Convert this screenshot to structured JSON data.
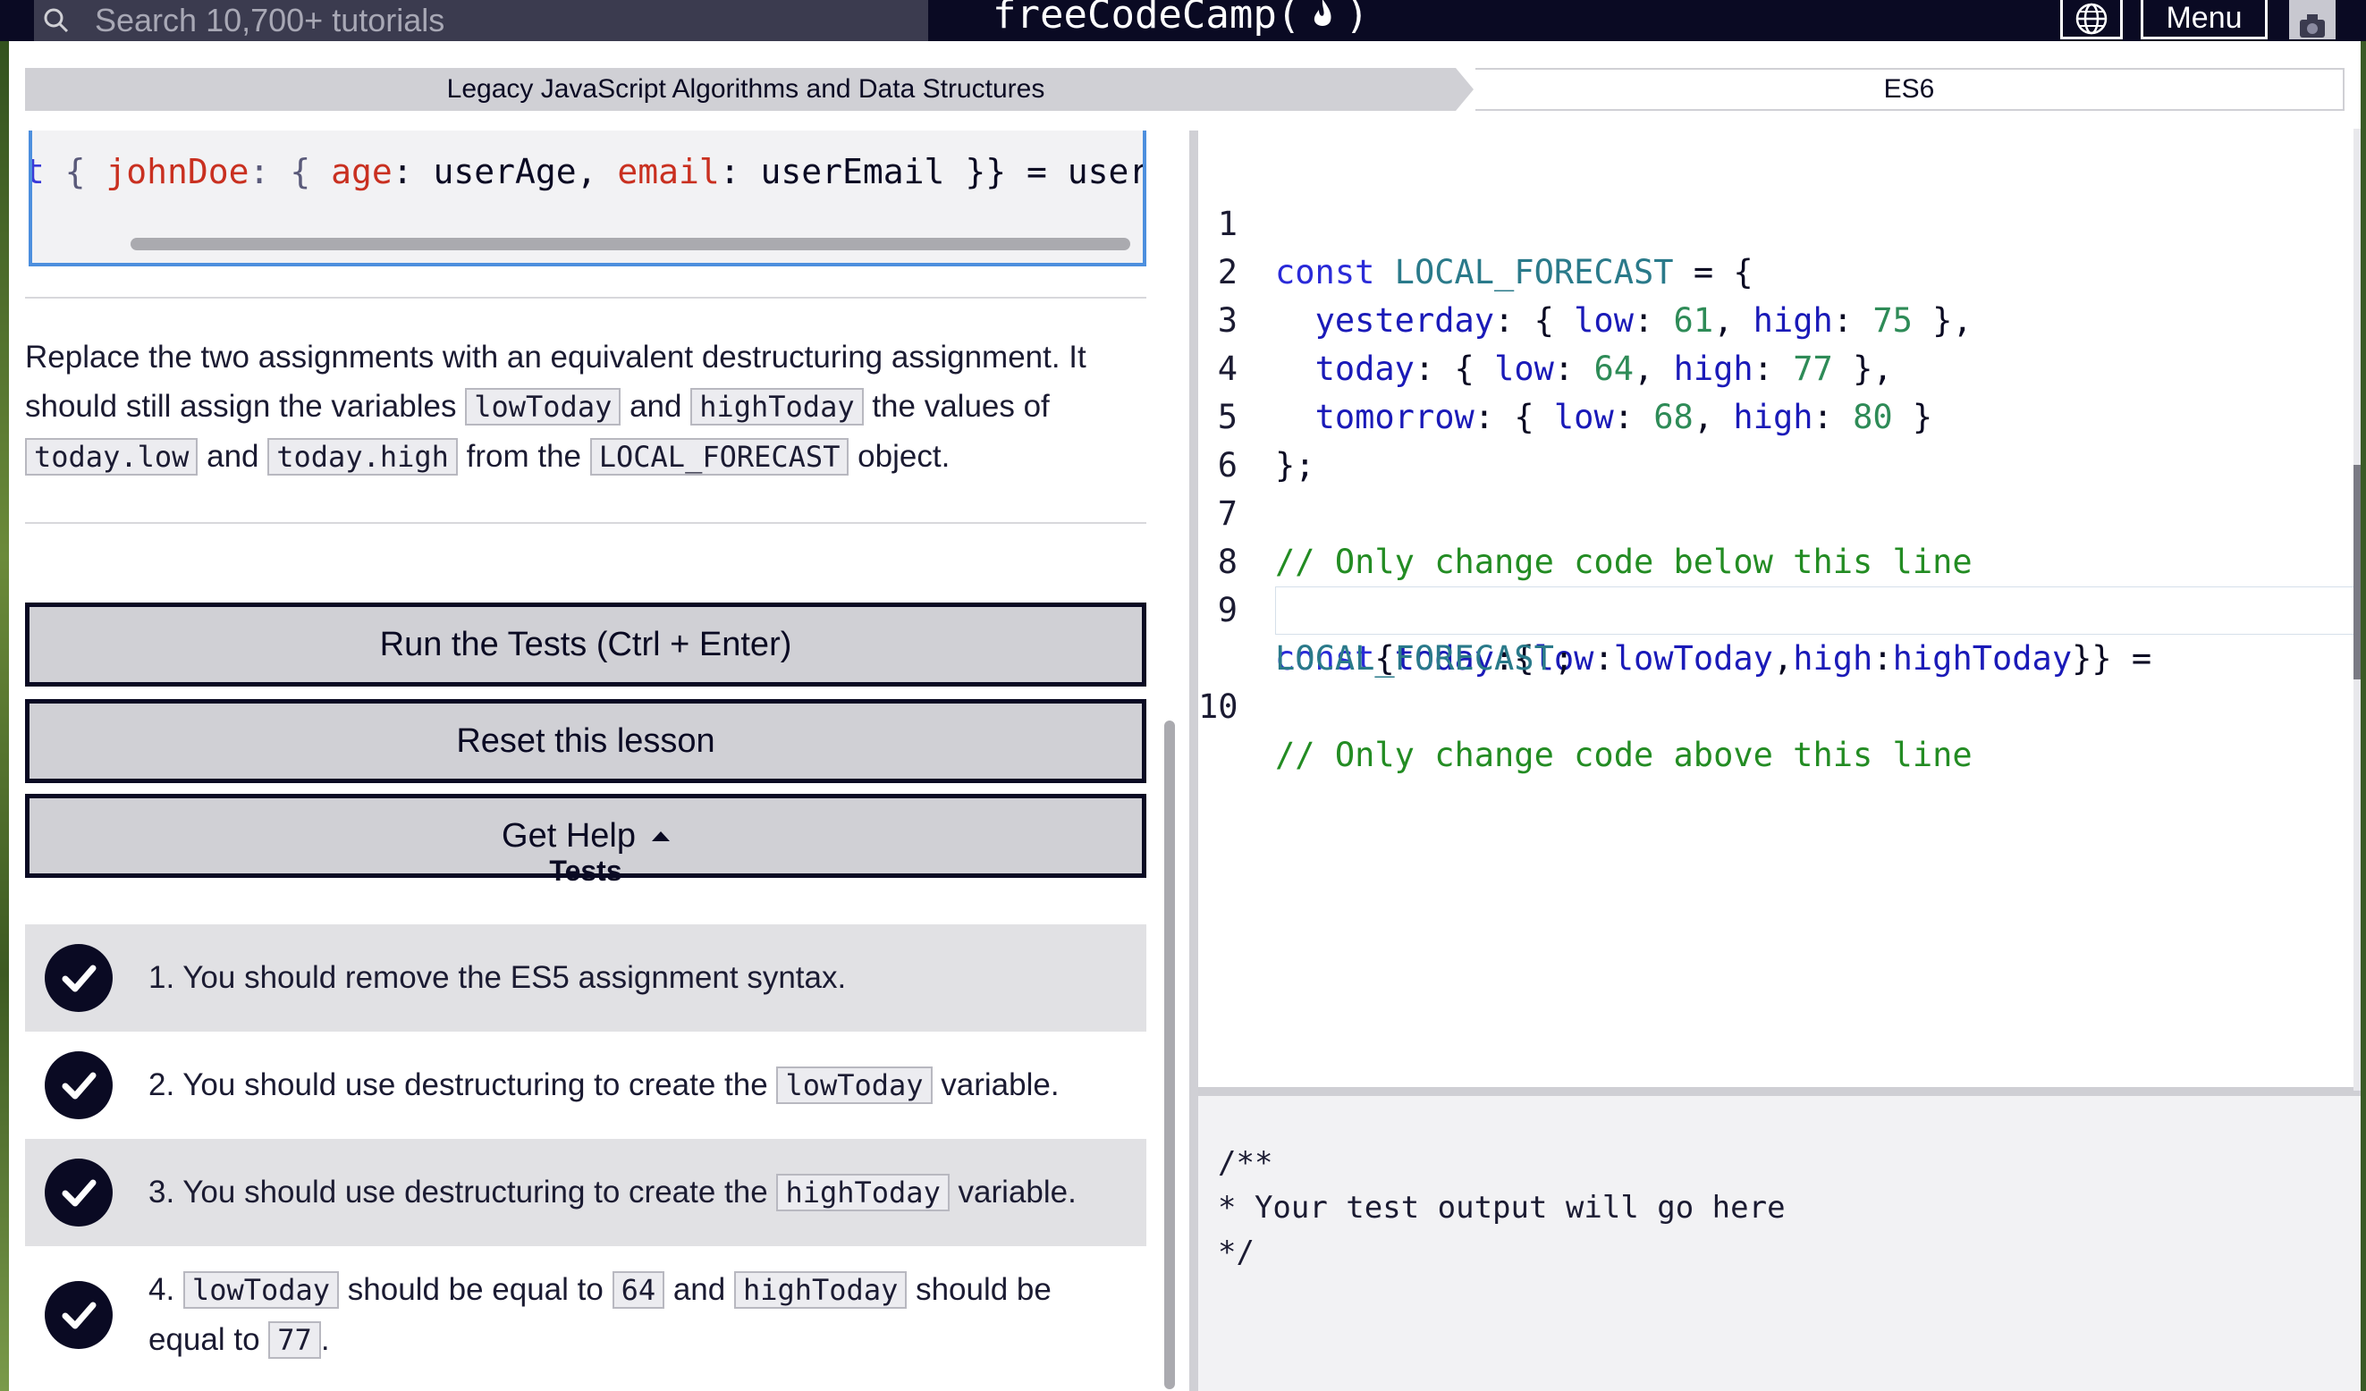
{
  "nav": {
    "search_placeholder": "Search 10,700+ tutorials",
    "brand_left": "freeCodeCamp(",
    "brand_right": ")",
    "menu_label": "Menu"
  },
  "breadcrumb": {
    "superblock": "Legacy JavaScript Algorithms and Data Structures",
    "block": "ES6"
  },
  "snippet": {
    "kw": "st",
    "p1": " { ",
    "prop1": "johnDoe",
    "p2": ": { ",
    "prop2": "age",
    "p3": ": userAge, ",
    "prop3": "email",
    "p4": ": userEmail }} = user;"
  },
  "description": {
    "t1": "Replace the two assignments with an equivalent destructuring assignment. It should still assign the variables ",
    "c1": "lowToday",
    "t2": " and ",
    "c2": "highToday",
    "t3": " the values of ",
    "c3": "today.low",
    "t4": " and ",
    "c4": "today.high",
    "t5": " from the ",
    "c5": "LOCAL_FORECAST",
    "t6": " object."
  },
  "buttons": {
    "run": "Run the Tests (Ctrl + Enter)",
    "reset": "Reset this lesson",
    "help": "Get Help"
  },
  "tests": {
    "title": "Tests",
    "t1": "1. You should remove the ES5 assignment syntax.",
    "t2a": "2. You should use destructuring to create the ",
    "t2c": "lowToday",
    "t2b": " variable.",
    "t3a": "3. You should use destructuring to create the ",
    "t3c": "highToday",
    "t3b": " variable.",
    "t4a": "4. ",
    "t4c1": "lowToday",
    "t4b": " should be equal to ",
    "t4c2": "64",
    "t4d": " and ",
    "t4c3": "highToday",
    "t4e": " should be equal to ",
    "t4c4": "77",
    "t4f": "."
  },
  "editor": {
    "l1": {
      "n": "1",
      "kw": "const",
      "var": "LOCAL_FORECAST",
      "rest": " = {"
    },
    "l2": {
      "n": "2",
      "prop": "yesterday",
      "a": ": { ",
      "p1": "low",
      "b": ": ",
      "v1": "61",
      "c": ", ",
      "p2": "high",
      "d": ": ",
      "v2": "75",
      "e": " },"
    },
    "l3": {
      "n": "3",
      "prop": "today",
      "a": ": { ",
      "p1": "low",
      "b": ": ",
      "v1": "64",
      "c": ", ",
      "p2": "high",
      "d": ": ",
      "v2": "77",
      "e": " },"
    },
    "l4": {
      "n": "4",
      "prop": "tomorrow",
      "a": ": { ",
      "p1": "low",
      "b": ": ",
      "v1": "68",
      "c": ", ",
      "p2": "high",
      "d": ": ",
      "v2": "80",
      "e": " }"
    },
    "l5": {
      "n": "5",
      "text": "};"
    },
    "l6": {
      "n": "6"
    },
    "l7": {
      "n": "7",
      "comment": "// Only change code below this line"
    },
    "l8": {
      "n": "8"
    },
    "l9": {
      "n": "9",
      "kw": "const",
      "a": "{",
      "p1": "today",
      "b": ":{",
      "p2": "low",
      "c": ":",
      "p3": "lowToday",
      "d": ",",
      "p4": "high",
      "e": ":",
      "p5": "highToday",
      "f": "}} ="
    },
    "l9b": {
      "var": "LOCAL_FORECAST",
      "rest": ";"
    },
    "l10": {
      "n": "10",
      "comment": "// Only change code above this line"
    }
  },
  "output": {
    "text": "/**\n* Your test output will go here\n*/"
  }
}
